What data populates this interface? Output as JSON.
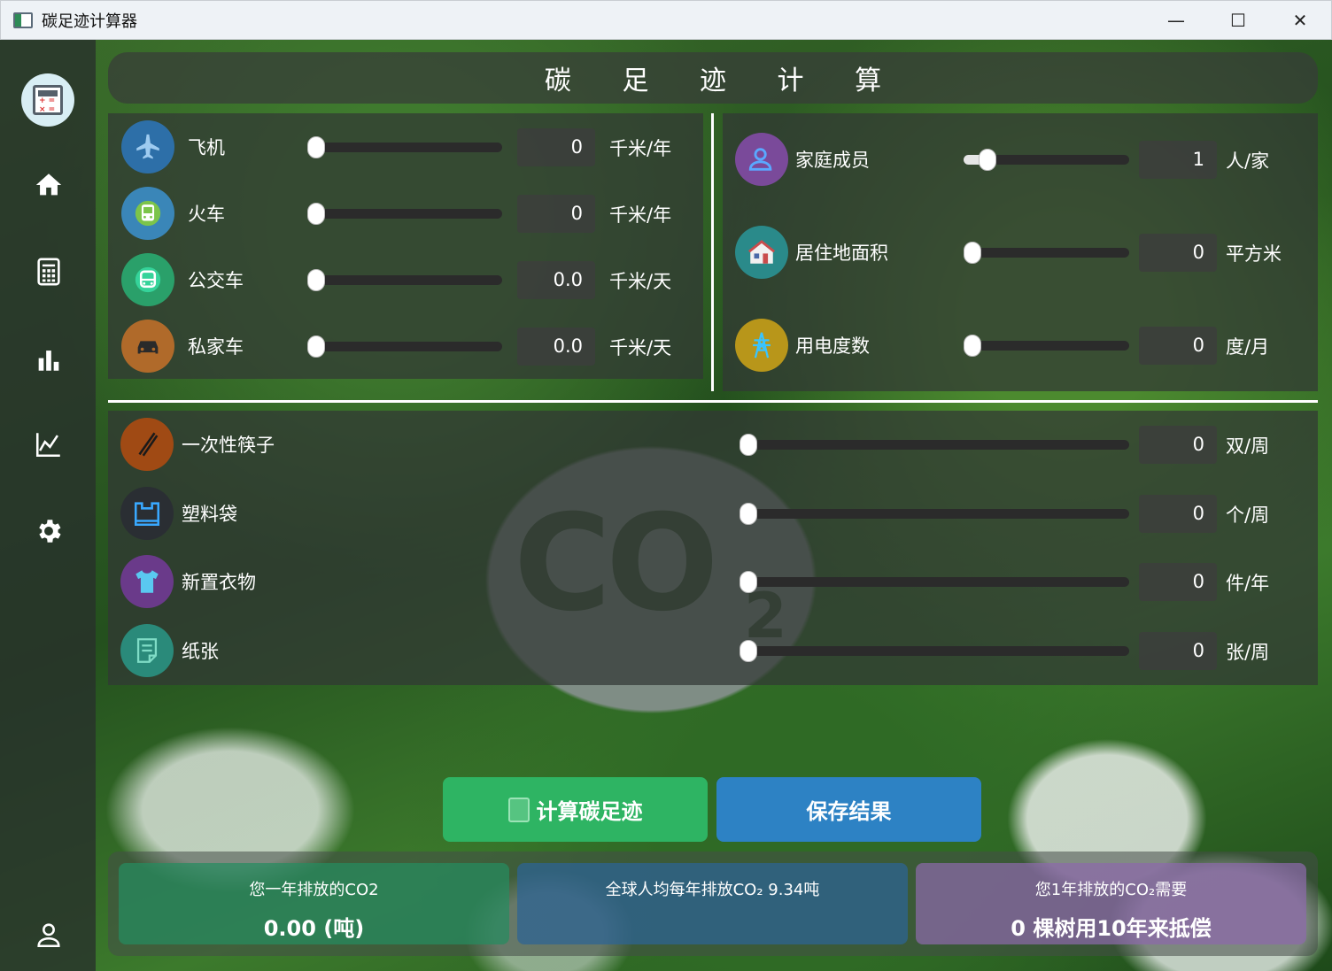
{
  "window": {
    "title": "碳足迹计算器",
    "minimize": "—",
    "maximize": "☐",
    "close": "✕"
  },
  "header": {
    "title": "碳 足 迹 计 算"
  },
  "background": {
    "co2_text": "CO",
    "co2_sub": "2"
  },
  "sidebar": {
    "items": [
      {
        "name": "home",
        "icon": "home-icon"
      },
      {
        "name": "calculator",
        "icon": "calculator-icon"
      },
      {
        "name": "bar-chart",
        "icon": "bar-chart-icon"
      },
      {
        "name": "line-chart",
        "icon": "line-chart-icon"
      },
      {
        "name": "settings",
        "icon": "gear-icon"
      },
      {
        "name": "user",
        "icon": "user-icon"
      }
    ]
  },
  "transport": [
    {
      "label": "飞机",
      "value": "0",
      "unit": "千米/年",
      "icon": "airplane-icon",
      "color": "#2d6fa8",
      "level": 0
    },
    {
      "label": "火车",
      "value": "0",
      "unit": "千米/年",
      "icon": "train-icon",
      "color": "#3a86b8",
      "level": 0
    },
    {
      "label": "公交车",
      "value": "0.0",
      "unit": "千米/天",
      "icon": "bus-icon",
      "color": "#2aa06a",
      "level": 0
    },
    {
      "label": "私家车",
      "value": "0.0",
      "unit": "千米/天",
      "icon": "car-icon",
      "color": "#b06a2a",
      "level": 0
    }
  ],
  "household": [
    {
      "label": "家庭成员",
      "value": "1",
      "unit": "人/家",
      "icon": "family-icon",
      "color": "#7a4a9a",
      "level": 0.1
    },
    {
      "label": "居住地面积",
      "value": "0",
      "unit": "平方米",
      "icon": "house-icon",
      "color": "#2a8a8a",
      "level": 0
    },
    {
      "label": "用电度数",
      "value": "0",
      "unit": "度/月",
      "icon": "power-tower-icon",
      "color": "#b8961a",
      "level": 0
    }
  ],
  "consumption": [
    {
      "label": "一次性筷子",
      "value": "0",
      "unit": "双/周",
      "icon": "chopsticks-icon",
      "color": "#a04a14",
      "level": 0
    },
    {
      "label": "塑料袋",
      "value": "0",
      "unit": "个/周",
      "icon": "plastic-bag-icon",
      "color": "#2a2e33",
      "level": 0
    },
    {
      "label": "新置衣物",
      "value": "0",
      "unit": "件/年",
      "icon": "shirt-icon",
      "color": "#6a3a8a",
      "level": 0
    },
    {
      "label": "纸张",
      "value": "0",
      "unit": "张/周",
      "icon": "paper-icon",
      "color": "#2a8a7a",
      "level": 0
    }
  ],
  "buttons": {
    "calculate": "计算碳足迹",
    "save": "保存结果"
  },
  "results": {
    "annual_label": "您一年排放的CO2",
    "annual_value": "0.00 (吨)",
    "global_label": "全球人均每年排放CO₂ 9.34吨",
    "trees_label": "您1年排放的CO₂需要",
    "trees_value": "0 棵树用10年来抵偿"
  }
}
